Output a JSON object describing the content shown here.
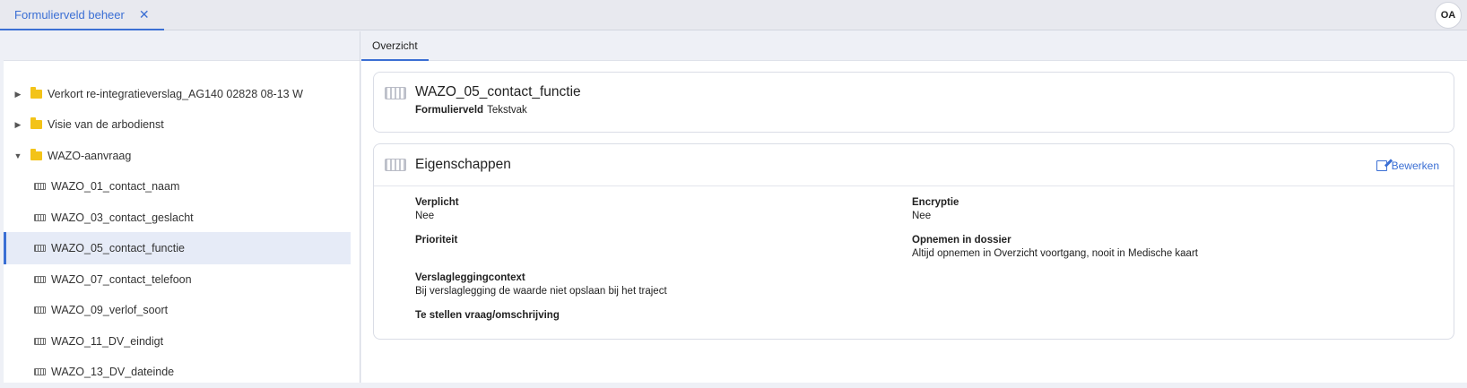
{
  "topbar": {
    "tab_label": "Formulierveld beheer",
    "tab_close": "✕",
    "avatar": "OA"
  },
  "tree": {
    "items": [
      {
        "label": "Verkort re-integratieverslag_AG140 02828 08-13 W",
        "type": "folder",
        "expanded": false
      },
      {
        "label": "Visie van de arbodienst",
        "type": "folder",
        "expanded": false
      },
      {
        "label": "WAZO-aanvraag",
        "type": "folder",
        "expanded": true
      },
      {
        "label": "WAZO_01_contact_naam",
        "type": "field"
      },
      {
        "label": "WAZO_03_contact_geslacht",
        "type": "field"
      },
      {
        "label": "WAZO_05_contact_functie",
        "type": "field",
        "selected": true
      },
      {
        "label": "WAZO_07_contact_telefoon",
        "type": "field"
      },
      {
        "label": "WAZO_09_verlof_soort",
        "type": "field"
      },
      {
        "label": "WAZO_11_DV_eindigt",
        "type": "field"
      },
      {
        "label": "WAZO_13_DV_dateinde",
        "type": "field"
      }
    ]
  },
  "main": {
    "tab": "Overzicht",
    "header": {
      "title": "WAZO_05_contact_functie",
      "type_label": "Formulierveld",
      "type_value": "Tekstvak"
    },
    "properties": {
      "title": "Eigenschappen",
      "edit_label": "Bewerken",
      "verplicht_label": "Verplicht",
      "verplicht_value": "Nee",
      "encryptie_label": "Encryptie",
      "encryptie_value": "Nee",
      "prioriteit_label": "Prioriteit",
      "prioriteit_value": "",
      "opnemen_label": "Opnemen in dossier",
      "opnemen_value": "Altijd opnemen in Overzicht voortgang, nooit in Medische kaart",
      "context_label": "Verslagleggingcontext",
      "context_value": "Bij verslaglegging de waarde niet opslaan bij het traject",
      "vraag_label": "Te stellen vraag/omschrijving",
      "vraag_value": ""
    }
  },
  "colors": {
    "accent": "#3b6fd4",
    "folder": "#f3c318",
    "selected_bg": "#e6ebf7"
  }
}
